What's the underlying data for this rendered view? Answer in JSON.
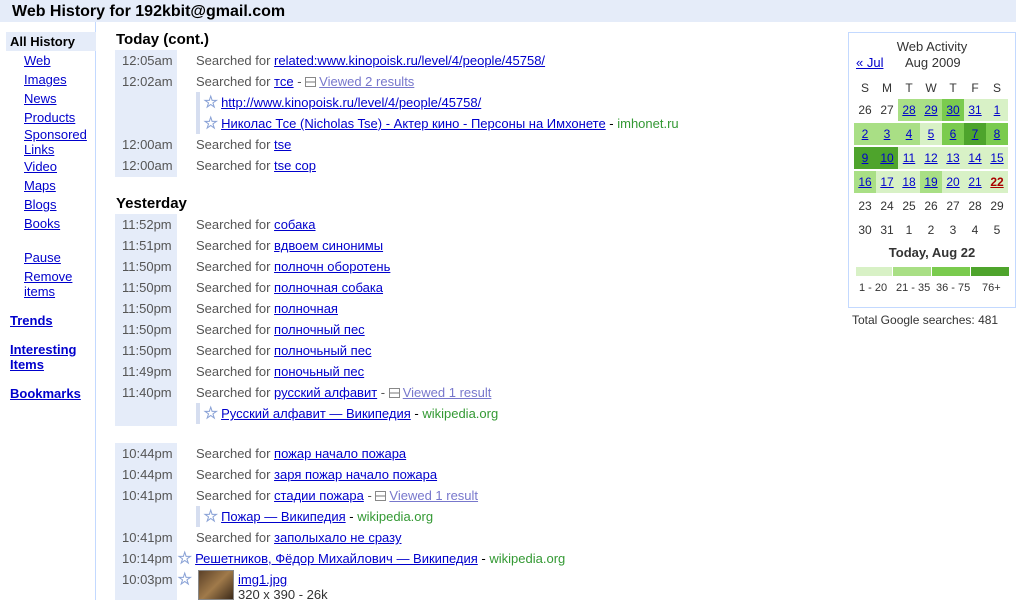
{
  "header": {
    "title": "Web History for 192kbit@gmail.com"
  },
  "sidebar": {
    "all_history": "All History",
    "items": [
      "Web",
      "Images",
      "News",
      "Products",
      "Sponsored",
      "Links",
      "Video",
      "Maps",
      "Blogs",
      "Books"
    ],
    "pause": "Pause",
    "remove": "Remove",
    "remove2": "items",
    "trends": "Trends",
    "interesting": "Interesting",
    "interesting2": "Items",
    "bookmarks": "Bookmarks"
  },
  "today": {
    "heading": "Today (cont.)",
    "rows": [
      {
        "time": "12:05am",
        "prefix": "Searched for ",
        "query": "related:www.kinopoisk.ru/level/4/people/45758/"
      },
      {
        "time": "12:02am",
        "prefix": "Searched for ",
        "query": "тсе",
        "viewed": "Viewed 2 results"
      },
      {
        "time": "12:00am",
        "prefix": "Searched for ",
        "query": "tse"
      },
      {
        "time": "12:00am",
        "prefix": "Searched for ",
        "query": "tse cop"
      }
    ],
    "results": [
      {
        "title": "http://www.kinopoisk.ru/level/4/people/45758/",
        "site": ""
      },
      {
        "title": "Николас Тсе (Nicholas Tse) - Актер кино - Персоны на Имхонете",
        "site": "imhonet.ru"
      }
    ]
  },
  "yesterday": {
    "heading": "Yesterday",
    "rows": [
      {
        "time": "11:52pm",
        "prefix": "Searched for ",
        "query": "собака"
      },
      {
        "time": "11:51pm",
        "prefix": "Searched for ",
        "query": "вдвоем синонимы"
      },
      {
        "time": "11:50pm",
        "prefix": "Searched for ",
        "query": "полночн оборотень"
      },
      {
        "time": "11:50pm",
        "prefix": "Searched for ",
        "query": "полночная собака"
      },
      {
        "time": "11:50pm",
        "prefix": "Searched for ",
        "query": "полночная"
      },
      {
        "time": "11:50pm",
        "prefix": "Searched for ",
        "query": "полночный пес"
      },
      {
        "time": "11:50pm",
        "prefix": "Searched for ",
        "query": "полночьный пес"
      },
      {
        "time": "11:49pm",
        "prefix": "Searched for ",
        "query": "поночьный пес"
      },
      {
        "time": "11:40pm",
        "prefix": "Searched for ",
        "query": "русский алфавит",
        "viewed": "Viewed 1 result"
      }
    ],
    "result1": {
      "title": "Русский алфавит — Википедия",
      "site": "wikipedia.org"
    },
    "rows2": [
      {
        "time": "10:44pm",
        "prefix": "Searched for ",
        "query": "пожар начало пожара"
      },
      {
        "time": "10:44pm",
        "prefix": "Searched for ",
        "query": "заря пожар начало пожара"
      },
      {
        "time": "10:41pm",
        "prefix": "Searched for ",
        "query": "стадии пожара",
        "viewed": "Viewed 1 result"
      },
      {
        "time": "10:41pm",
        "prefix": "Searched for ",
        "query": "заполыхало не сразу"
      }
    ],
    "result2": {
      "title": "Пожар — Википедия",
      "site": "wikipedia.org"
    },
    "visit": {
      "time": "10:14pm",
      "title": "Решетников, Фёдор Михайлович — Википедия",
      "site": "wikipedia.org"
    },
    "image": {
      "time": "10:03pm",
      "title": "img1.jpg",
      "meta": "320 x 390 - 26k"
    }
  },
  "calendar": {
    "title": "Web Activity",
    "prev": "« Jul",
    "month": "Aug 2009",
    "dow": [
      "S",
      "M",
      "T",
      "W",
      "T",
      "F",
      "S"
    ],
    "weeks": [
      [
        "26",
        "27",
        "28",
        "29",
        "30",
        "31",
        "1"
      ],
      [
        "2",
        "3",
        "4",
        "5",
        "6",
        "7",
        "8"
      ],
      [
        "9",
        "10",
        "11",
        "12",
        "13",
        "14",
        "15"
      ],
      [
        "16",
        "17",
        "18",
        "19",
        "20",
        "21",
        "22"
      ],
      [
        "23",
        "24",
        "25",
        "26",
        "27",
        "28",
        "29"
      ],
      [
        "30",
        "31",
        "1",
        "2",
        "3",
        "4",
        "5"
      ]
    ],
    "today_label": "Today, Aug 22",
    "legend": [
      "1 - 20",
      "21 - 35",
      "36 - 75",
      "76+"
    ],
    "legend_colors": [
      "#d8f1c6",
      "#a9df85",
      "#7acb4e",
      "#4ea42c"
    ]
  },
  "total": "Total Google searches: 481",
  "colors": {
    "link": "#00c",
    "site": "#393",
    "header_bg": "#e5ecf9"
  },
  "icons": {
    "star": "star-icon",
    "viewed": "viewed-results-icon"
  }
}
